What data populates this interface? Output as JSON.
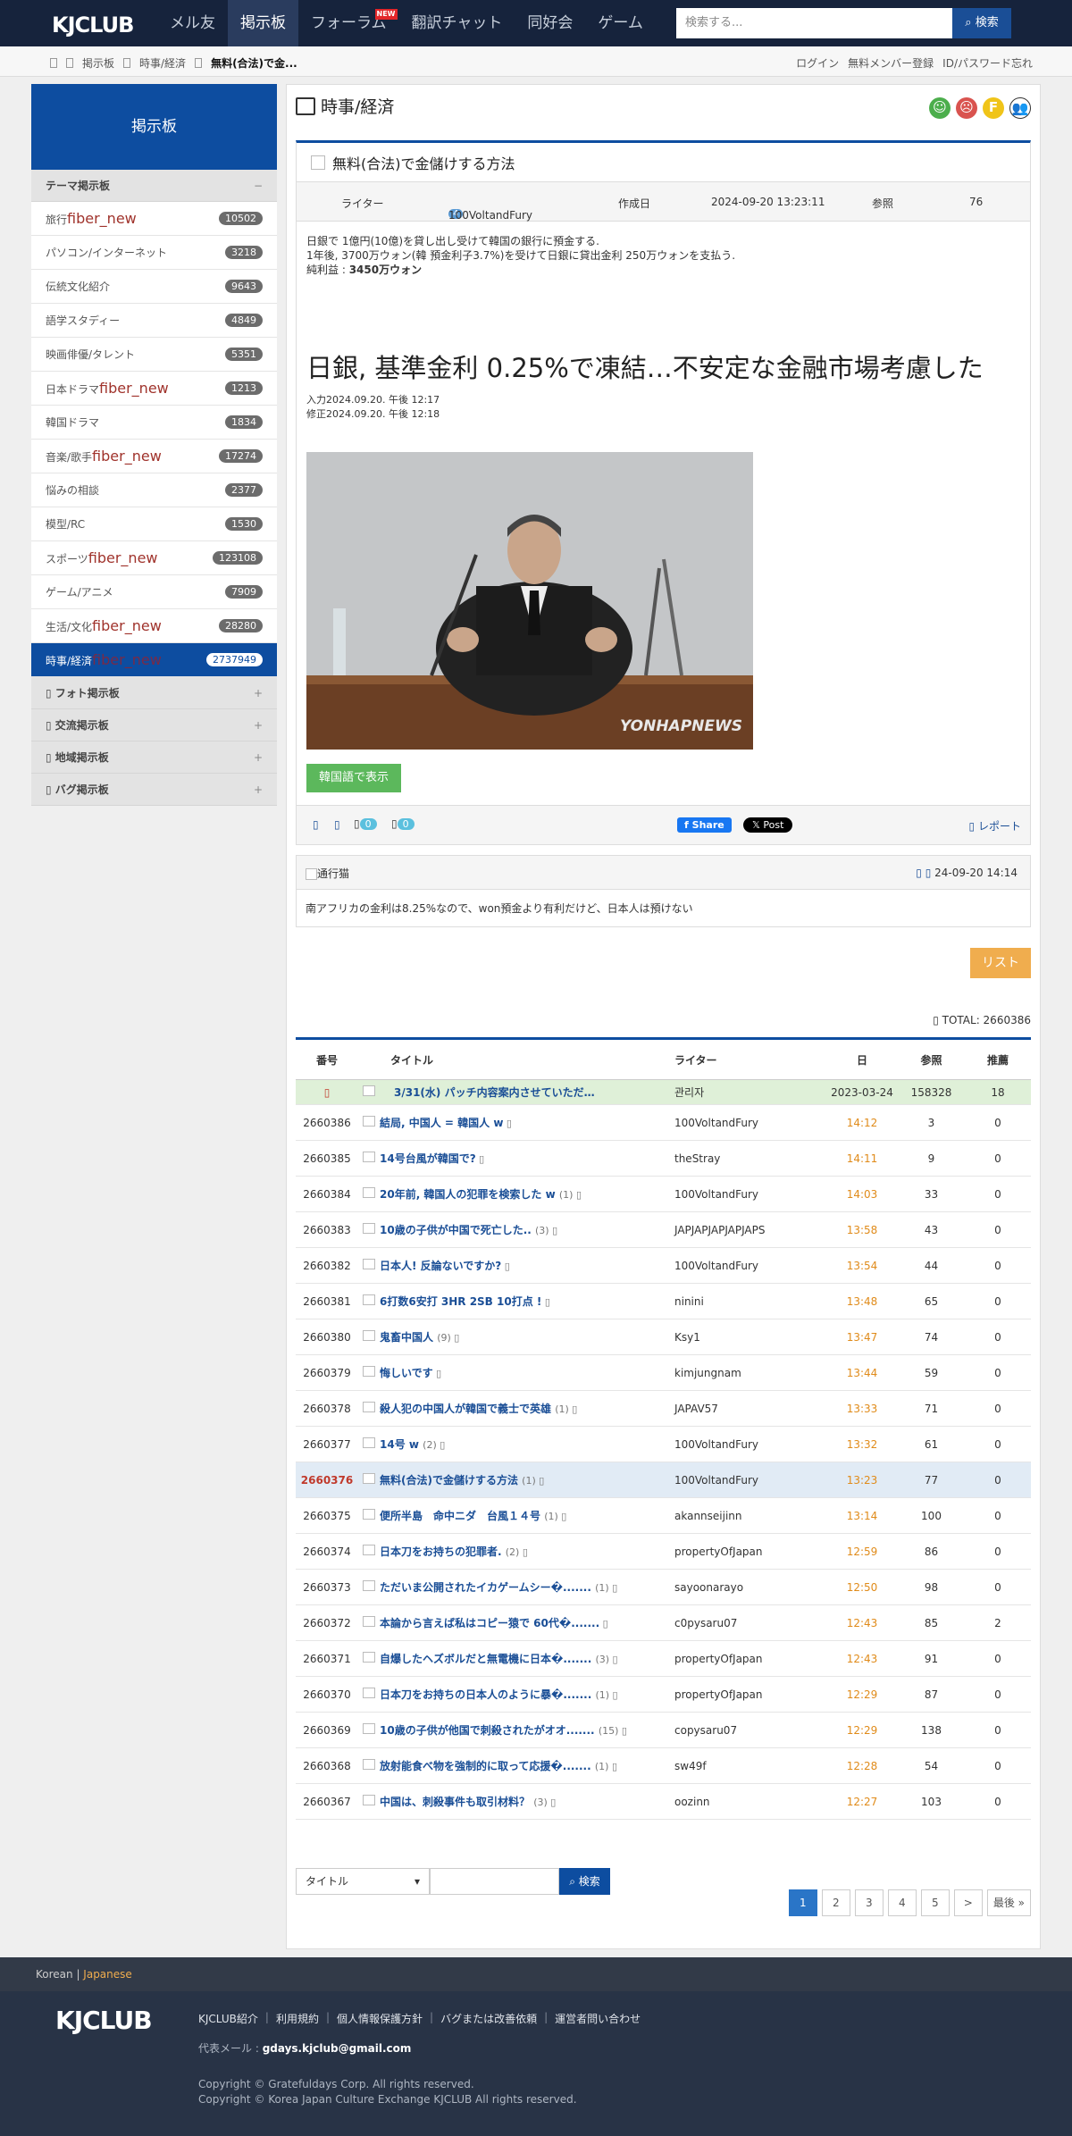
{
  "nav": {
    "logo": "KJCLUB",
    "items": [
      "メル友",
      "掲示板",
      "フォーラム",
      "翻訳チャット",
      "同好会",
      "ゲーム"
    ],
    "new_badge": "NEW",
    "search_placeholder": "検索する...",
    "search_btn": "検索"
  },
  "sub": {
    "crumbs": [
      "掲示板",
      "時事/経済",
      "無料(合法)で金..."
    ],
    "links": [
      "ログイン",
      "無料メンバー登録",
      "ID/パスワード忘れ"
    ]
  },
  "side": {
    "head": "掲示板",
    "group_theme": "テーマ掲示板",
    "minus": "−",
    "plus": "+",
    "items": [
      {
        "label": "旅行",
        "fn": "fiber_new",
        "count": "10502"
      },
      {
        "label": "パソコン/インターネット",
        "fn": "",
        "count": "3218"
      },
      {
        "label": "伝統文化紹介",
        "fn": "",
        "count": "9643"
      },
      {
        "label": "語学スタディー",
        "fn": "",
        "count": "4849"
      },
      {
        "label": "映画俳優/タレント",
        "fn": "",
        "count": "5351"
      },
      {
        "label": "日本ドラマ",
        "fn": "fiber_new",
        "count": "1213"
      },
      {
        "label": "韓国ドラマ",
        "fn": "",
        "count": "1834"
      },
      {
        "label": "音楽/歌手",
        "fn": "fiber_new",
        "count": "17274"
      },
      {
        "label": "悩みの相談",
        "fn": "",
        "count": "2377"
      },
      {
        "label": "模型/RC",
        "fn": "",
        "count": "1530"
      },
      {
        "label": "スポーツ",
        "fn": "fiber_new",
        "count": "123108"
      },
      {
        "label": "ゲーム/アニメ",
        "fn": "",
        "count": "7909"
      },
      {
        "label": "生活/文化",
        "fn": "fiber_new",
        "count": "28280"
      },
      {
        "label": "時事/経済",
        "fn": "fiber_new",
        "count": "2737949"
      }
    ],
    "groups": [
      "フォト掲示板",
      "交流掲示板",
      "地域掲示板",
      "バグ掲示板"
    ]
  },
  "main": {
    "title": "時事/経済",
    "post": {
      "title": "無料(合法)で金儲けする方法",
      "writer_label": "ライター",
      "level": "4",
      "writer": "100VoltandFury",
      "date_label": "作成日",
      "date": "2024-09-20 13:23:11",
      "views_label": "参照",
      "views": "76",
      "line1": "日銀で 1億円(10億)を貸し出し受けて韓国の銀行に預金する.",
      "line2": "1年後, 3700万ウォン(韓 預金利子3.7%)を受けて日銀に貸出金利 250万ウォンを支払う.",
      "line3_label": "純利益 : ",
      "line3_value": "3450万ウォン",
      "headline": "日銀, 基準金利 0.25%で凍結…不安定な金融市場考慮した",
      "input": "入力2024.09.20. 午後 12:17",
      "modified": "修正2024.09.20. 午後 12:18",
      "watermark": "YONHAPNEWS",
      "korean_btn": "韓国語で表示",
      "c1": "0",
      "c2": "0",
      "share": "Share",
      "xpost": "Post",
      "report": "レポート"
    },
    "comment": {
      "author": "通行猫",
      "date": "24-09-20 14:14",
      "text": "南アフリカの金利は8.25%なので、won預金より有利だけど、日本人は預けない"
    },
    "list_btn": "リスト",
    "total": "TOTAL: 2660386",
    "headers": [
      "番号",
      "タイトル",
      "ライター",
      "日",
      "参照",
      "推薦"
    ],
    "notice": {
      "title": "3/31(水) パッチ内容案内させていただ…",
      "writer": "관리자",
      "date": "2023-03-24",
      "views": "158328",
      "rec": "18"
    },
    "rows": [
      {
        "num": "2660386",
        "title": "結局, 中国人 = 韓国人 w",
        "cmt": "",
        "writer": "100VoltandFury",
        "time": "14:12",
        "views": "3",
        "rec": "0"
      },
      {
        "num": "2660385",
        "title": "14号台風が韓国で?",
        "cmt": "",
        "writer": "theStray",
        "time": "14:11",
        "views": "9",
        "rec": "0"
      },
      {
        "num": "2660384",
        "title": "20年前, 韓国人の犯罪を検索した w",
        "cmt": "(1)",
        "writer": "100VoltandFury",
        "time": "14:03",
        "views": "33",
        "rec": "0"
      },
      {
        "num": "2660383",
        "title": "10歳の子供が中国で死亡した..",
        "cmt": "(3)",
        "writer": "JAPJAPJAPJAPJAPS",
        "time": "13:58",
        "views": "43",
        "rec": "0"
      },
      {
        "num": "2660382",
        "title": "日本人! 反論ないですか?",
        "cmt": "",
        "writer": "100VoltandFury",
        "time": "13:54",
        "views": "44",
        "rec": "0"
      },
      {
        "num": "2660381",
        "title": "6打数6安打 3HR 2SB 10打点 !",
        "cmt": "",
        "writer": "ninini",
        "time": "13:48",
        "views": "65",
        "rec": "0"
      },
      {
        "num": "2660380",
        "title": "鬼畜中国人",
        "cmt": "(9)",
        "writer": "Ksy1",
        "time": "13:47",
        "views": "74",
        "rec": "0"
      },
      {
        "num": "2660379",
        "title": "悔しいです",
        "cmt": "",
        "writer": "kimjungnam",
        "time": "13:44",
        "views": "59",
        "rec": "0"
      },
      {
        "num": "2660378",
        "title": "殺人犯の中国人が韓国で義士で英雄",
        "cmt": "(1)",
        "writer": "JAPAV57",
        "time": "13:33",
        "views": "71",
        "rec": "0"
      },
      {
        "num": "2660377",
        "title": "14号 w",
        "cmt": "(2)",
        "writer": "100VoltandFury",
        "time": "13:32",
        "views": "61",
        "rec": "0"
      },
      {
        "num": "2660376",
        "title": "無料(合法)で金儲けする方法",
        "cmt": "(1)",
        "writer": "100VoltandFury",
        "time": "13:23",
        "views": "77",
        "rec": "0"
      },
      {
        "num": "2660375",
        "title": "便所半島　命中ニダ　台風１４号",
        "cmt": "(1)",
        "writer": "akannseijinn",
        "time": "13:14",
        "views": "100",
        "rec": "0"
      },
      {
        "num": "2660374",
        "title": "日本刀をお持ちの犯罪者.",
        "cmt": "(2)",
        "writer": "propertyOfJapan",
        "time": "12:59",
        "views": "86",
        "rec": "0"
      },
      {
        "num": "2660373",
        "title": "ただいま公開されたイカゲームシー�.......",
        "cmt": "(1)",
        "writer": "sayoonarayo",
        "time": "12:50",
        "views": "98",
        "rec": "0"
      },
      {
        "num": "2660372",
        "title": "本論から言えば私はコピー猿で 60代�.......",
        "cmt": "",
        "writer": "c0pysaru07",
        "time": "12:43",
        "views": "85",
        "rec": "2"
      },
      {
        "num": "2660371",
        "title": "自爆したヘズボルだと無電機に日本�.......",
        "cmt": "(3)",
        "writer": "propertyOfJapan",
        "time": "12:43",
        "views": "91",
        "rec": "0"
      },
      {
        "num": "2660370",
        "title": "日本刀をお持ちの日本人のように暴�.......",
        "cmt": "(1)",
        "writer": "propertyOfJapan",
        "time": "12:29",
        "views": "87",
        "rec": "0"
      },
      {
        "num": "2660369",
        "title": "10歳の子供が他国で刺殺されたがオオ.......",
        "cmt": "(15)",
        "writer": "copysaru07",
        "time": "12:29",
        "views": "138",
        "rec": "0"
      },
      {
        "num": "2660368",
        "title": "放射能食べ物を強制的に取って応援�.......",
        "cmt": "(1)",
        "writer": "sw49f",
        "time": "12:28",
        "views": "54",
        "rec": "0"
      },
      {
        "num": "2660367",
        "title": "中国は、刺殺事件も取引材料？",
        "cmt": "(3)",
        "writer": "oozinn",
        "time": "12:27",
        "views": "103",
        "rec": "0"
      }
    ],
    "search_select": "タイトル",
    "search_btn": "検索",
    "pages": [
      "1",
      "2",
      "3",
      "4",
      "5",
      ">",
      "最後 »"
    ]
  },
  "footer": {
    "lang_ko": "Korean",
    "lang_sep": " | ",
    "lang_ja": "Japanese",
    "logo": "KJCLUB",
    "links": [
      "KJCLUB紹介",
      "利用規約",
      "個人情報保護方針",
      "バグまたは改善依頼",
      "運営者問い合わせ"
    ],
    "mail_label": "代表メール : ",
    "mail": "gdays.kjclub@gmail.com",
    "copy1": "Copyright © Gratefuldays Corp. All rights reserved.",
    "copy2": "Copyright © Korea Japan Culture Exchange KJCLUB All rights reserved."
  }
}
